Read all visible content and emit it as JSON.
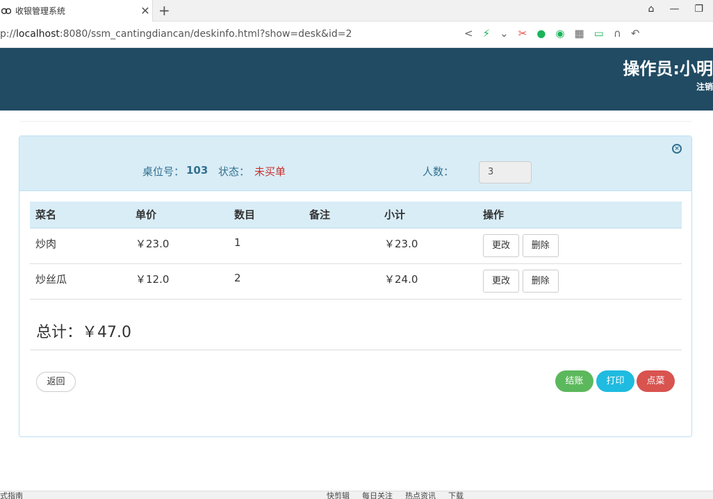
{
  "browser": {
    "tab_title": "收银管理系统",
    "tab_close": "✕",
    "new_tab": "+",
    "url_prefix": "p://",
    "url_host": "localhost",
    "url_rest": ":8080/ssm_cantingdiancan/deskinfo.html?show=desk&id=2"
  },
  "header": {
    "operator": "操作员:小明",
    "logout": "注销"
  },
  "desk": {
    "label": "桌位号：",
    "number": "103",
    "status_label": "状态：",
    "status_value": "未买单",
    "people_label": "人数：",
    "people_value": "3"
  },
  "table": {
    "headers": [
      "菜名",
      "单价",
      "数目",
      "备注",
      "小计",
      "操作"
    ],
    "rows": [
      {
        "name": "炒肉",
        "price": "￥23.0",
        "qty": "1",
        "note": "",
        "subtotal": "￥23.0",
        "edit": "更改",
        "delete": "删除"
      },
      {
        "name": "炒丝瓜",
        "price": "￥12.0",
        "qty": "2",
        "note": "",
        "subtotal": "￥24.0",
        "edit": "更改",
        "delete": "删除"
      }
    ]
  },
  "total": "总计：￥47.0",
  "actions": {
    "back": "返回",
    "settle": "结账",
    "print": "打印",
    "order": "点菜"
  },
  "statusbar": {
    "left": "式指南",
    "items": [
      "快剪辑",
      "每日关注",
      "热点资讯",
      "下载"
    ]
  },
  "colors": {
    "header_bg": "#214b63",
    "panel_head_bg": "#d9edf7",
    "settle": "#5cb85c",
    "print": "#1fbbe0",
    "order": "#d9534f"
  }
}
